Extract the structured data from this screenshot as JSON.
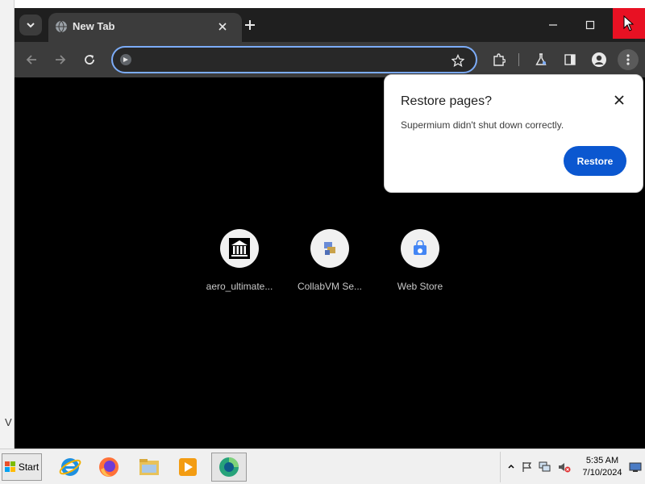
{
  "browser": {
    "tab": {
      "title": "New Tab"
    },
    "omnibox": {
      "value": "",
      "placeholder": ""
    }
  },
  "restore_bubble": {
    "title": "Restore pages?",
    "message": "Supermium didn't shut down correctly.",
    "restore_label": "Restore"
  },
  "shortcuts": [
    {
      "label": "aero_ultimate...",
      "icon": "museum-icon"
    },
    {
      "label": "CollabVM Se...",
      "icon": "collabvm-icon"
    },
    {
      "label": "Web Store",
      "icon": "web-store-icon"
    }
  ],
  "desktop": {
    "edge_text": "V"
  },
  "taskbar": {
    "start_label": "Start",
    "apps": [
      "internet-explorer-icon",
      "firefox-icon",
      "file-explorer-icon",
      "media-player-icon",
      "supermium-icon"
    ],
    "clock": {
      "time": "5:35 AM",
      "date": "7/10/2024"
    }
  },
  "colors": {
    "accent": "#0b57d0",
    "close_red": "#e81123",
    "omnibox_border": "#7cacf8"
  }
}
